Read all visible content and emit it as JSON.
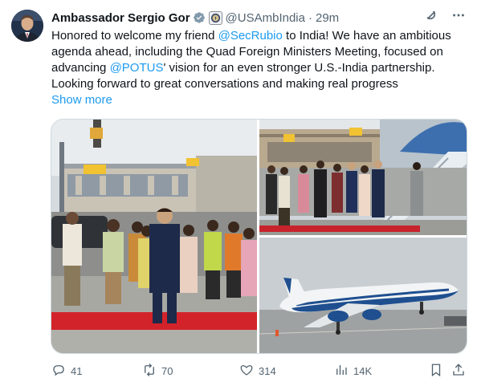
{
  "author": {
    "name": "Ambassador Sergio Gor",
    "handle": "@USAmbIndia",
    "separator": "·",
    "time": "29m"
  },
  "text": {
    "part1": "Honored to welcome my friend ",
    "mention1": "@SecRubio",
    "part2": " to India! We have an ambitious agenda ahead, including the Quad Foreign Ministers Meeting, focused on advancing ",
    "mention2": "@POTUS",
    "part3": "' vision for an even stronger U.S.-India partnership. Looking forward to great conversations and making real progress",
    "show_more": "Show more"
  },
  "actions": {
    "replies": "41",
    "reposts": "70",
    "likes": "314",
    "views": "14K"
  },
  "colors": {
    "accent": "#1d9bf0",
    "muted": "#536471",
    "text": "#0f1419",
    "verified_badge": "#829aab"
  },
  "icons": {
    "verified": "verified-badge-icon",
    "seal": "government-seal-icon",
    "grok": "grok-icon",
    "more": "more-icon",
    "reply": "reply-icon",
    "repost": "repost-icon",
    "like": "heart-icon",
    "views": "views-icon",
    "bookmark": "bookmark-icon",
    "share": "share-icon"
  }
}
